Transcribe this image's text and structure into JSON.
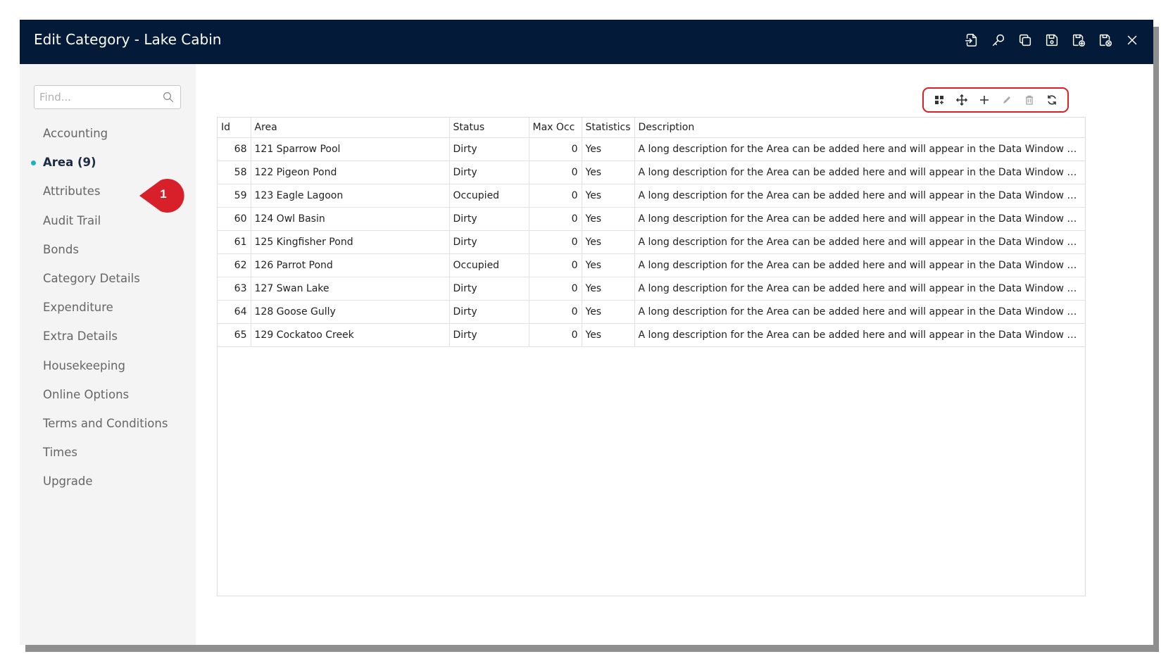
{
  "window": {
    "title": "Edit Category - Lake Cabin"
  },
  "titlebar_icons": [
    "import-icon",
    "key-icon",
    "copy-icon",
    "save-icon",
    "save-add-icon",
    "save-close-icon",
    "close-icon"
  ],
  "sidebar": {
    "search_placeholder": "Find...",
    "items": [
      {
        "label": "Accounting"
      },
      {
        "label": "Area (9)",
        "active": true
      },
      {
        "label": "Attributes"
      },
      {
        "label": "Audit Trail"
      },
      {
        "label": "Bonds"
      },
      {
        "label": "Category Details"
      },
      {
        "label": "Expenditure"
      },
      {
        "label": "Extra Details"
      },
      {
        "label": "Housekeeping"
      },
      {
        "label": "Online Options"
      },
      {
        "label": "Terms and Conditions"
      },
      {
        "label": "Times"
      },
      {
        "label": "Upgrade"
      }
    ]
  },
  "callout": {
    "number": "1",
    "color": "#d8202a"
  },
  "toolbar": {
    "highlight_color": "#d8202a",
    "tools": [
      "grid-icon",
      "move-icon",
      "add-icon",
      "edit-icon",
      "delete-icon",
      "refresh-icon"
    ]
  },
  "grid": {
    "columns": [
      "Id",
      "Area",
      "Status",
      "Max Occ",
      "Statistics",
      "Description"
    ],
    "rows": [
      {
        "id": "68",
        "area": "121 Sparrow Pool",
        "status": "Dirty",
        "max_occ": "0",
        "statistics": "Yes",
        "description": "A long description for the Area can be added here and will appear in the Data Window when hove..."
      },
      {
        "id": "58",
        "area": "122 Pigeon Pond",
        "status": "Dirty",
        "max_occ": "0",
        "statistics": "Yes",
        "description": "A long description for the Area can be added here and will appear in the Data Window when hove..."
      },
      {
        "id": "59",
        "area": "123 Eagle Lagoon",
        "status": "Occupied",
        "max_occ": "0",
        "statistics": "Yes",
        "description": "A long description for the Area can be added here and will appear in the Data Window when hove..."
      },
      {
        "id": "60",
        "area": "124 Owl Basin",
        "status": "Dirty",
        "max_occ": "0",
        "statistics": "Yes",
        "description": "A long description for the Area can be added here and will appear in the Data Window when hove..."
      },
      {
        "id": "61",
        "area": "125 Kingfisher Pond",
        "status": "Dirty",
        "max_occ": "0",
        "statistics": "Yes",
        "description": "A long description for the Area can be added here and will appear in the Data Window when hove..."
      },
      {
        "id": "62",
        "area": "126 Parrot Pond",
        "status": "Occupied",
        "max_occ": "0",
        "statistics": "Yes",
        "description": "A long description for the Area can be added here and will appear in the Data Window when hove..."
      },
      {
        "id": "63",
        "area": "127 Swan Lake",
        "status": "Dirty",
        "max_occ": "0",
        "statistics": "Yes",
        "description": "A long description for the Area can be added here and will appear in the Data Window when hove..."
      },
      {
        "id": "64",
        "area": "128 Goose Gully",
        "status": "Dirty",
        "max_occ": "0",
        "statistics": "Yes",
        "description": "A long description for the Area can be added here and will appear in the Data Window when hove..."
      },
      {
        "id": "65",
        "area": "129 Cockatoo Creek",
        "status": "Dirty",
        "max_occ": "0",
        "statistics": "Yes",
        "description": "A long description for the Area can be added here and will appear in the Data Window when hove..."
      }
    ]
  }
}
